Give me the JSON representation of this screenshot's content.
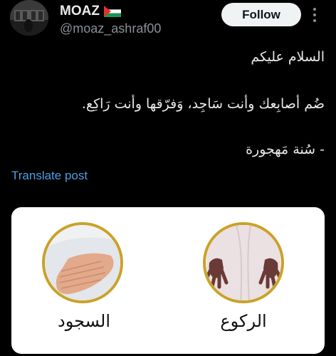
{
  "user": {
    "display_name": "MOAZ",
    "handle": "@moaz_ashraf00",
    "follow_label": "Follow"
  },
  "post": {
    "lines": [
      "السلام عليكم",
      "ضُم أصابِعك وأنت سَاجِد، وَفرّقها وأنت رَاكِع.",
      "- سُنة مَهجورة"
    ],
    "translate_label": "Translate post"
  },
  "media": {
    "captions": [
      "السجود",
      "الركوع"
    ]
  },
  "colors": {
    "background": "#000000",
    "text": "#e7e9ea",
    "muted": "#8b8f94",
    "link": "#4f9de4",
    "follow_bg": "#eff3f4",
    "ring": "#c9a227"
  },
  "icons": [
    "avatar",
    "palestine-flag-icon",
    "more-options-icon"
  ]
}
